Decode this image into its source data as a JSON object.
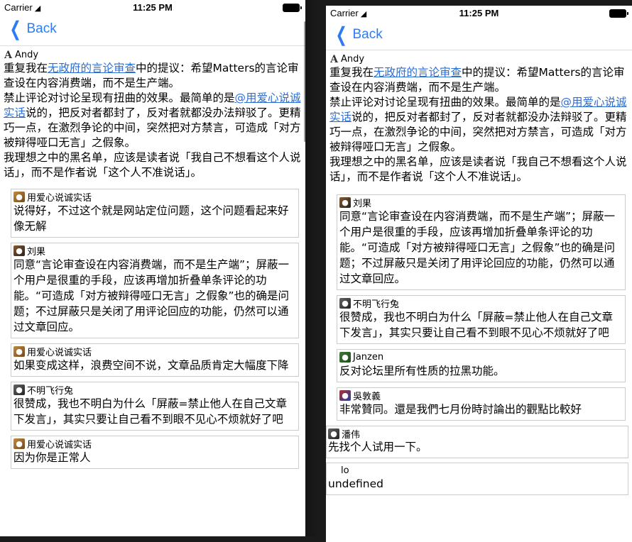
{
  "status": {
    "carrier": "Carrier",
    "time": "11:25 PM"
  },
  "nav": {
    "back_label": "Back"
  },
  "left": {
    "post": {
      "author": "Andy",
      "p1_prefix": "重复我在",
      "p1_link": "无政府的言论审查",
      "p1_suffix": "中的提议：希望Matters的言论审查设在内容消费端，而不是生产端。",
      "p2_prefix": "禁止评论对讨论呈现有扭曲的效果。最简单的是",
      "p2_link": "@用爱心说诚实话",
      "p2_suffix": "说的，把反对者都封了，反对者就都没办法辩驳了。更精巧一点，在激烈争论的中间，突然把对方禁言，可造成「对方被辩得哑口无言」之假象。",
      "p3": "我理想之中的黑名单，应该是读者说「我自己不想看这个人说话」，而不是作者说「这个人不准说话」。"
    },
    "replies": [
      {
        "author": "用爱心说诚实话",
        "text": "说得好，不过这个就是网站定位问题，这个问题看起来好像无解"
      },
      {
        "author": "刘果",
        "text": "同意“言论审查设在内容消费端，而不是生产端”；屏蔽一个用户是很重的手段，应该再增加折叠单条评论的功能。“可造成「对方被辩得哑口无言」之假象”也的确是问题；不过屏蔽只是关闭了用评论回应的功能，仍然可以通过文章回应。"
      },
      {
        "author": "用爱心说诚实话",
        "text": "如果变成这样，浪费空间不说，文章品质肯定大幅度下降"
      },
      {
        "author": "不明飞行兔",
        "text": "很赞成，我也不明白为什么「屏蔽=禁止他人在自己文章下发言」，其实只要让自己看不到眼不见心不烦就好了吧"
      },
      {
        "author": "用爱心说诚实话",
        "text": "因为你是正常人"
      }
    ]
  },
  "right": {
    "post": {
      "author": "Andy",
      "p1_prefix": "重复我在",
      "p1_link": "无政府的言论审查",
      "p1_suffix": "中的提议：希望Matters的言论审查设在内容消费端，而不是生产端。",
      "p2_prefix": "禁止评论对讨论呈现有扭曲的效果。最简单的是",
      "p2_link": "@用爱心说诚实话",
      "p2_suffix": "说的，把反对者都封了，反对者就都没办法辩驳了。更精巧一点，在激烈争论的中间，突然把对方禁言，可造成「对方被辩得哑口无言」之假象。",
      "p3": "我理想之中的黑名单，应该是读者说「我自己不想看这个人说话」，而不是作者说「这个人不准说话」。"
    },
    "replies": [
      {
        "author": "刘果",
        "text": "同意“言论审查设在内容消费端，而不是生产端”；屏蔽一个用户是很重的手段，应该再增加折叠单条评论的功能。“可造成「对方被辩得哑口无言」之假象”也的确是问题；不过屏蔽只是关闭了用评论回应的功能，仍然可以通过文章回应。"
      },
      {
        "author": "不明飞行兔",
        "text": "很赞成，我也不明白为什么「屏蔽=禁止他人在自己文章下发言」，其实只要让自己看不到眼不见心不烦就好了吧"
      },
      {
        "author": "Janzen",
        "text": "反对论坛里所有性质的拉黑功能。"
      },
      {
        "author": "吳敦義",
        "text": "非常贊同。還是我們七月份時討論出的觀點比較好"
      }
    ],
    "post2": {
      "author": "潘伟",
      "text": "先找个人试用一下。"
    },
    "post3": {
      "author": "lo",
      "text": "undefined"
    }
  }
}
